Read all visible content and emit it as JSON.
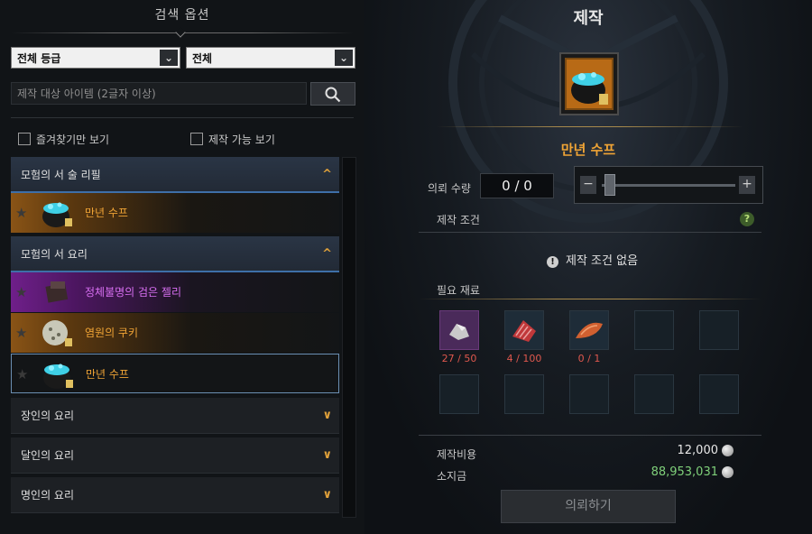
{
  "search": {
    "title": "검색 옵션",
    "grade_dropdown": "전체 등급",
    "type_dropdown": "전체",
    "input_placeholder": "제작 대상 아이템 (2글자 이상)",
    "favorites_only": "즐겨찾기만 보기",
    "craftable_only": "제작 가능 보기"
  },
  "list": {
    "categories": [
      {
        "label": "모험의 서 술 리필",
        "open": true
      },
      {
        "label": "모험의 서 요리",
        "open": true
      },
      {
        "label": "장인의 요리",
        "open": false
      },
      {
        "label": "달인의 요리",
        "open": false
      },
      {
        "label": "명인의 요리",
        "open": false
      }
    ],
    "items": [
      {
        "name": "만년 수프",
        "grade": "orange"
      },
      {
        "name": "정체불명의 검은 젤리",
        "grade": "purple"
      },
      {
        "name": "염원의 쿠키",
        "grade": "orange"
      },
      {
        "name": "만년 수프",
        "grade": "orange"
      }
    ]
  },
  "craft": {
    "title": "제작",
    "item_name": "만년 수프",
    "request_qty_label": "의뢰 수량",
    "request_qty_value": "0 / 0",
    "minus": "−",
    "plus": "+",
    "conditions_label": "제작 조건",
    "help": "?",
    "no_conditions": "제작 조건 없음",
    "info": "!",
    "materials_label": "필요 재료",
    "materials": [
      {
        "count": "27 / 50",
        "icon": "ore-icon"
      },
      {
        "count": "4 / 100",
        "icon": "meat-icon"
      },
      {
        "count": "0 / 1",
        "icon": "fish-fillet-icon"
      }
    ],
    "cost_label": "제작비용",
    "cost_value": "12,000",
    "owned_label": "소지금",
    "owned_value": "88,953,031",
    "request_button": "의뢰하기"
  },
  "colors": {
    "orange_grade": "#f0a435",
    "purple_grade": "#d86ff2",
    "shortage": "#e0584e",
    "owned_money": "#7fd07a"
  }
}
